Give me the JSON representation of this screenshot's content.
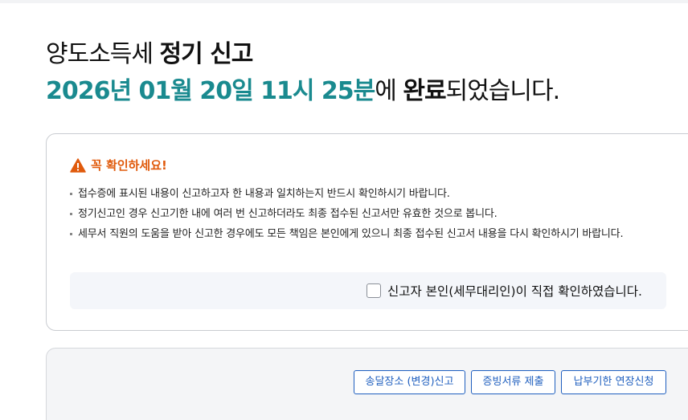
{
  "heading": {
    "line1_prefix": "양도소득세 ",
    "line1_bold": "정기 신고",
    "datetime": "2026년 01월 20일 11시 25분",
    "line2_mid": "에 ",
    "line2_bold": "완료",
    "line2_suffix": "되었습니다."
  },
  "notice": {
    "title": "꼭 확인하세요!",
    "icon": "warning-triangle-icon",
    "accent_color": "#e05a0c",
    "bullets": [
      "접수증에 표시된 내용이 신고하고자 한 내용과 일치하는지 반드시 확인하시기 바랍니다.",
      "정기신고인 경우 신고기한 내에 여러 번 신고하더라도 최종 접수된 신고서만 유효한 것으로 봅니다.",
      "세무서 직원의 도움을 받아 신고한 경우에도 모든 책임은 본인에게 있으니 최종 접수된 신고서 내용을 다시 확인하시기 바랍니다."
    ],
    "confirm_label": "신고자 본인(세무대리인)이 직접 확인하였습니다.",
    "confirm_checked": false
  },
  "actions": {
    "btn_delivery": "송달장소 (변경)신고",
    "btn_documents": "증빙서류 제출",
    "btn_extension": "납부기한 연장신청"
  },
  "colors": {
    "datetime": "#1a8a8f",
    "button": "#1f5fbf"
  }
}
